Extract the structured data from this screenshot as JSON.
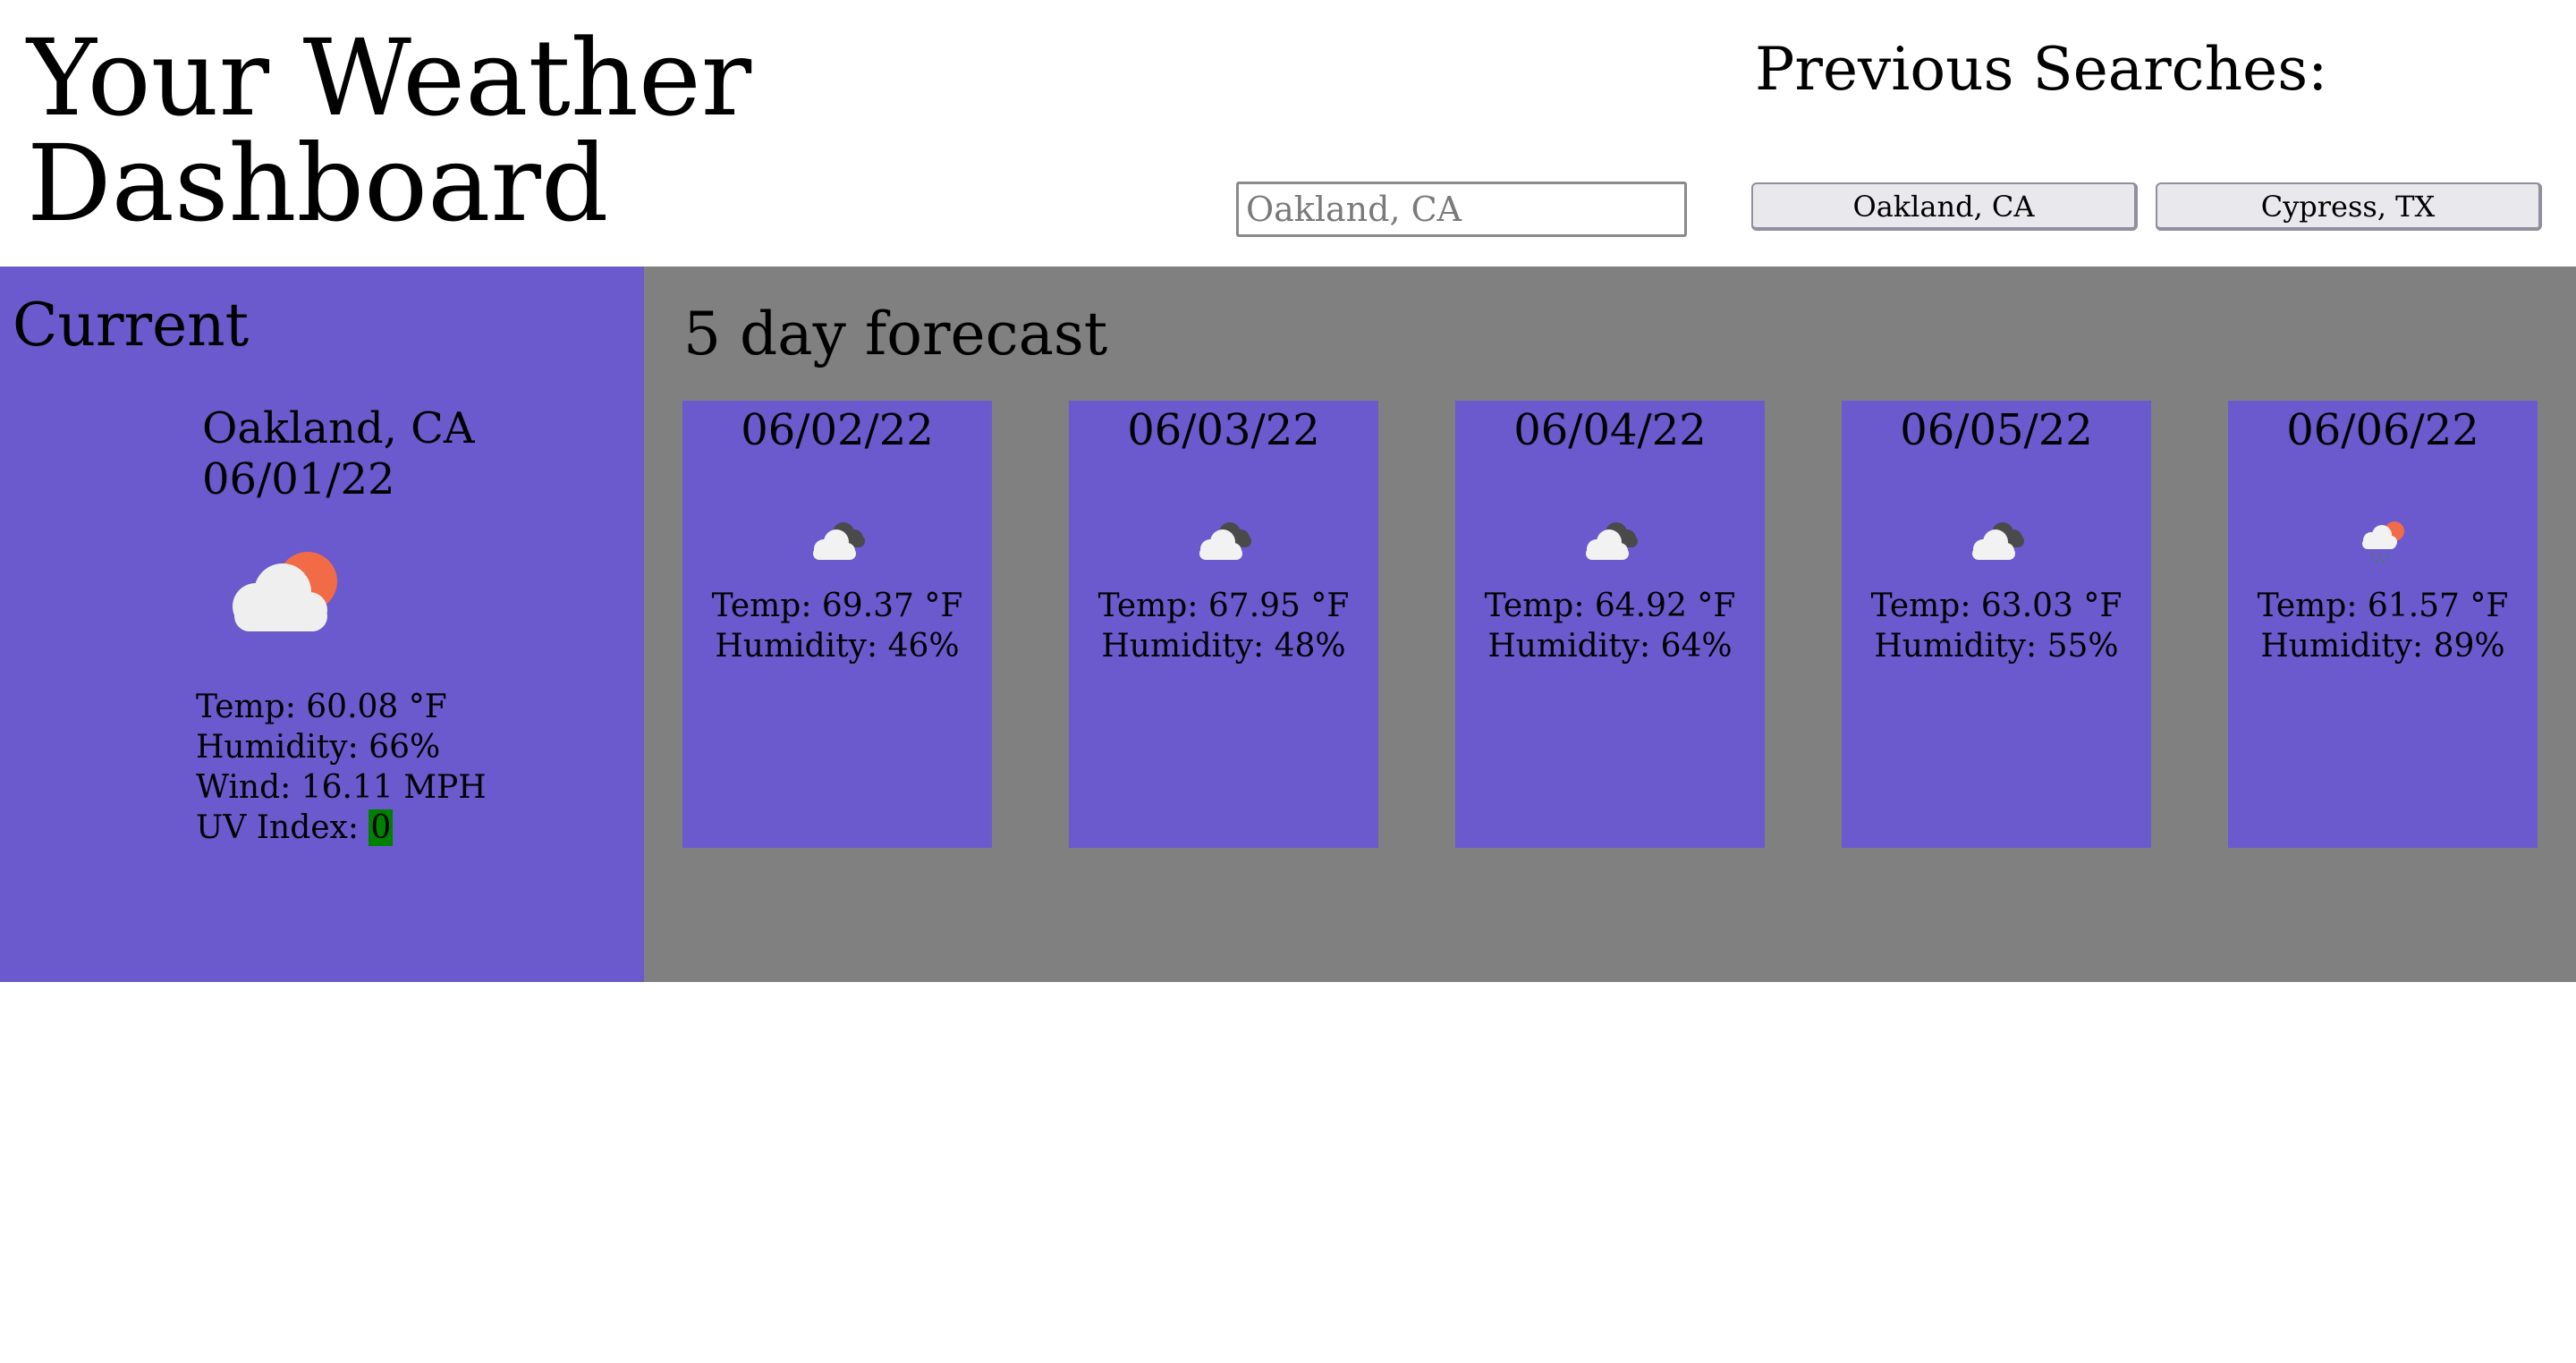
{
  "header": {
    "title": "Your Weather Dashboard",
    "previous_label": "Previous Searches:",
    "search_placeholder": "Oakland, CA",
    "history": [
      "Oakland, CA",
      "Cypress, TX"
    ]
  },
  "current": {
    "heading": "Current",
    "city": "Oakland, CA",
    "date": "06/01/22",
    "icon": "partly-cloudy-sun-icon",
    "temp": "Temp: 60.08 °F",
    "humidity": "Humidity: 66%",
    "wind": "Wind: 16.11 MPH",
    "uv_label": "UV Index: ",
    "uv_value": "0",
    "uv_color": "#008000"
  },
  "forecast": {
    "heading": "5 day forecast",
    "days": [
      {
        "date": "06/02/22",
        "icon": "broken-clouds-icon",
        "temp": "Temp: 69.37 °F",
        "humidity": "Humidity: 46%"
      },
      {
        "date": "06/03/22",
        "icon": "broken-clouds-icon",
        "temp": "Temp: 67.95 °F",
        "humidity": "Humidity: 48%"
      },
      {
        "date": "06/04/22",
        "icon": "broken-clouds-icon",
        "temp": "Temp: 64.92 °F",
        "humidity": "Humidity: 64%"
      },
      {
        "date": "06/05/22",
        "icon": "broken-clouds-icon",
        "temp": "Temp: 63.03 °F",
        "humidity": "Humidity: 55%"
      },
      {
        "date": "06/06/22",
        "icon": "rain-sun-icon",
        "temp": "Temp: 61.57 °F",
        "humidity": "Humidity: 89%"
      }
    ]
  },
  "colors": {
    "panel": "#6a5acd",
    "forecast_bg": "#808080",
    "sun": "#f26b47"
  }
}
